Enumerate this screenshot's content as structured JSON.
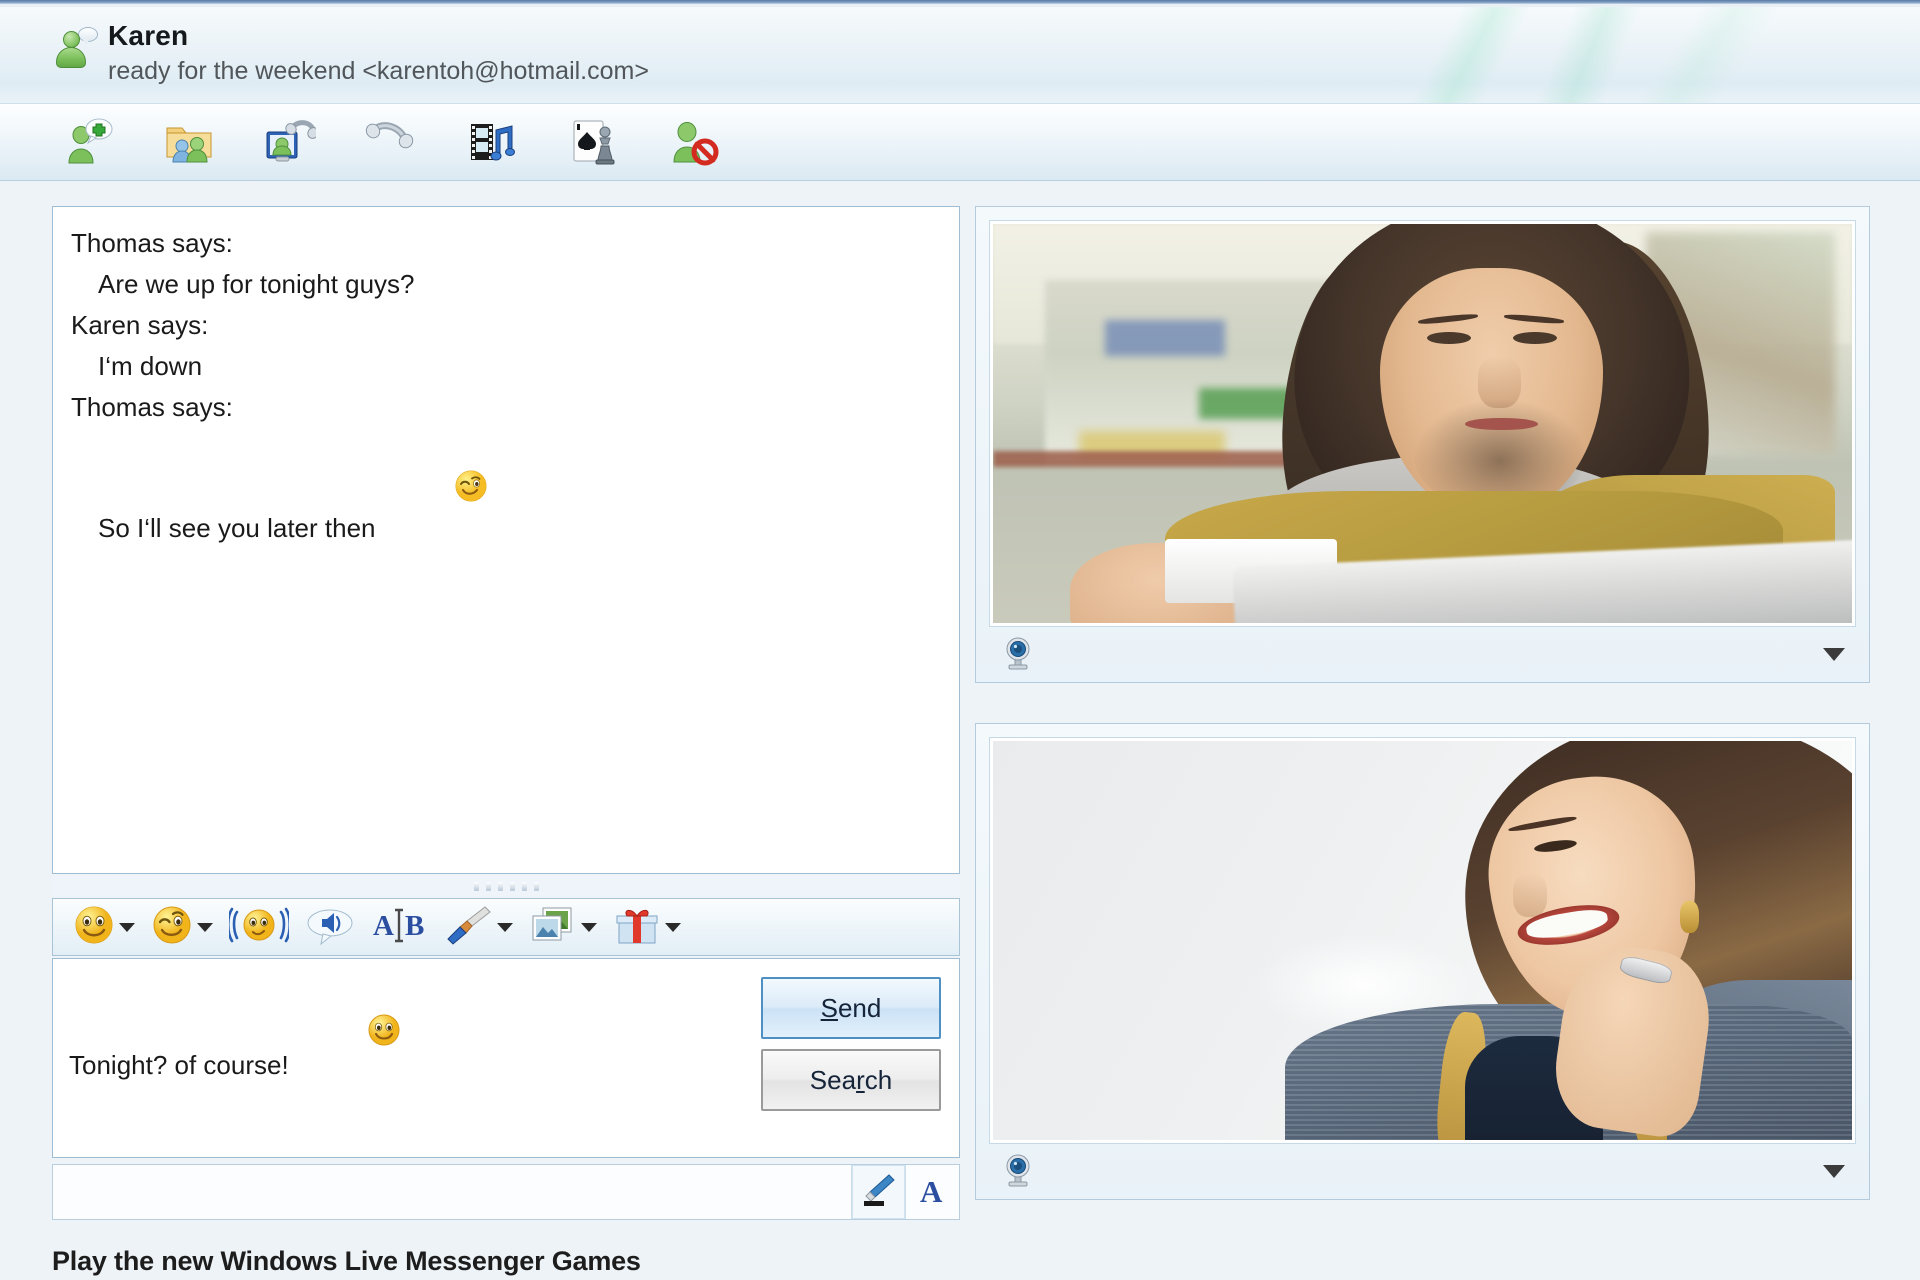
{
  "window": {
    "contact_name": "Karen",
    "status_message": "ready for the weekend <karentoh@hotmail.com>"
  },
  "toolbar": {
    "items": [
      {
        "name": "invite-contact",
        "icon": "invite-person-icon",
        "label": "Invite"
      },
      {
        "name": "shared-folders",
        "icon": "shared-folder-icon",
        "label": "Shared folders"
      },
      {
        "name": "video-call",
        "icon": "video-call-icon",
        "label": "Video"
      },
      {
        "name": "voice-call",
        "icon": "phone-call-icon",
        "label": "Call"
      },
      {
        "name": "share-media",
        "icon": "film-music-icon",
        "label": "Photos & media"
      },
      {
        "name": "games",
        "icon": "cards-chess-icon",
        "label": "Games"
      },
      {
        "name": "block-contact",
        "icon": "block-person-icon",
        "label": "Block"
      }
    ]
  },
  "conversation": {
    "messages": [
      {
        "sender": "Thomas says:",
        "text": "Are we up for tonight guys?",
        "emoticon": ""
      },
      {
        "sender": "Karen says:",
        "text": "I‘m down",
        "emoticon": ""
      },
      {
        "sender": "Thomas says:",
        "text": "So I‘ll see you later then",
        "emoticon": "wink-emoticon"
      }
    ]
  },
  "format_toolbar": {
    "items": [
      {
        "name": "emoticon-picker",
        "icon": "smiley-icon",
        "has_caret": true
      },
      {
        "name": "wink-picker",
        "icon": "wink-smiley-icon",
        "has_caret": true
      },
      {
        "name": "nudge",
        "icon": "nudge-icon",
        "has_caret": false
      },
      {
        "name": "sound",
        "icon": "sound-bubble-icon",
        "has_caret": false
      },
      {
        "name": "font-select",
        "icon": "font-ab-icon",
        "has_caret": false
      },
      {
        "name": "background-brush",
        "icon": "paintbrush-icon",
        "has_caret": true
      },
      {
        "name": "backgrounds",
        "icon": "photo-icon",
        "has_caret": true
      },
      {
        "name": "gift",
        "icon": "gift-icon",
        "has_caret": true
      }
    ]
  },
  "compose": {
    "text": "Tonight? of course!",
    "emoticon": "smile-emoticon",
    "send_label_pre": "",
    "send_label_underline": "S",
    "send_label_post": "end",
    "search_label_pre": "Sea",
    "search_label_underline": "r",
    "search_label_post": "ch"
  },
  "status_bar": {
    "items": [
      {
        "name": "handwriting",
        "icon": "pen-icon"
      },
      {
        "name": "text-mode",
        "icon": "letter-a-icon"
      }
    ]
  },
  "promo": {
    "text": "Play the new Windows Live Messenger Games"
  },
  "webcam_panels": [
    {
      "name": "remote-webcam",
      "icon": "webcam-icon",
      "caret": "chevron-down-icon",
      "description": "Man with long brown hair in olive jacket and grey hoodie holding a white mug, blurred cafe background"
    },
    {
      "name": "local-webcam",
      "icon": "webcam-icon",
      "caret": "chevron-down-icon",
      "description": "Smiling woman with brown bob haircut in grey knit cardigan with gold trim, hand resting on chin, bright white background"
    }
  ],
  "colors": {
    "frame_blue": "#5b7ba6",
    "panel_border": "#b3cbdc",
    "header_bg": "#eaf2f7",
    "accent_green": "#7cc05c",
    "send_border": "#4f90c4",
    "text": "#1a1a1a"
  }
}
